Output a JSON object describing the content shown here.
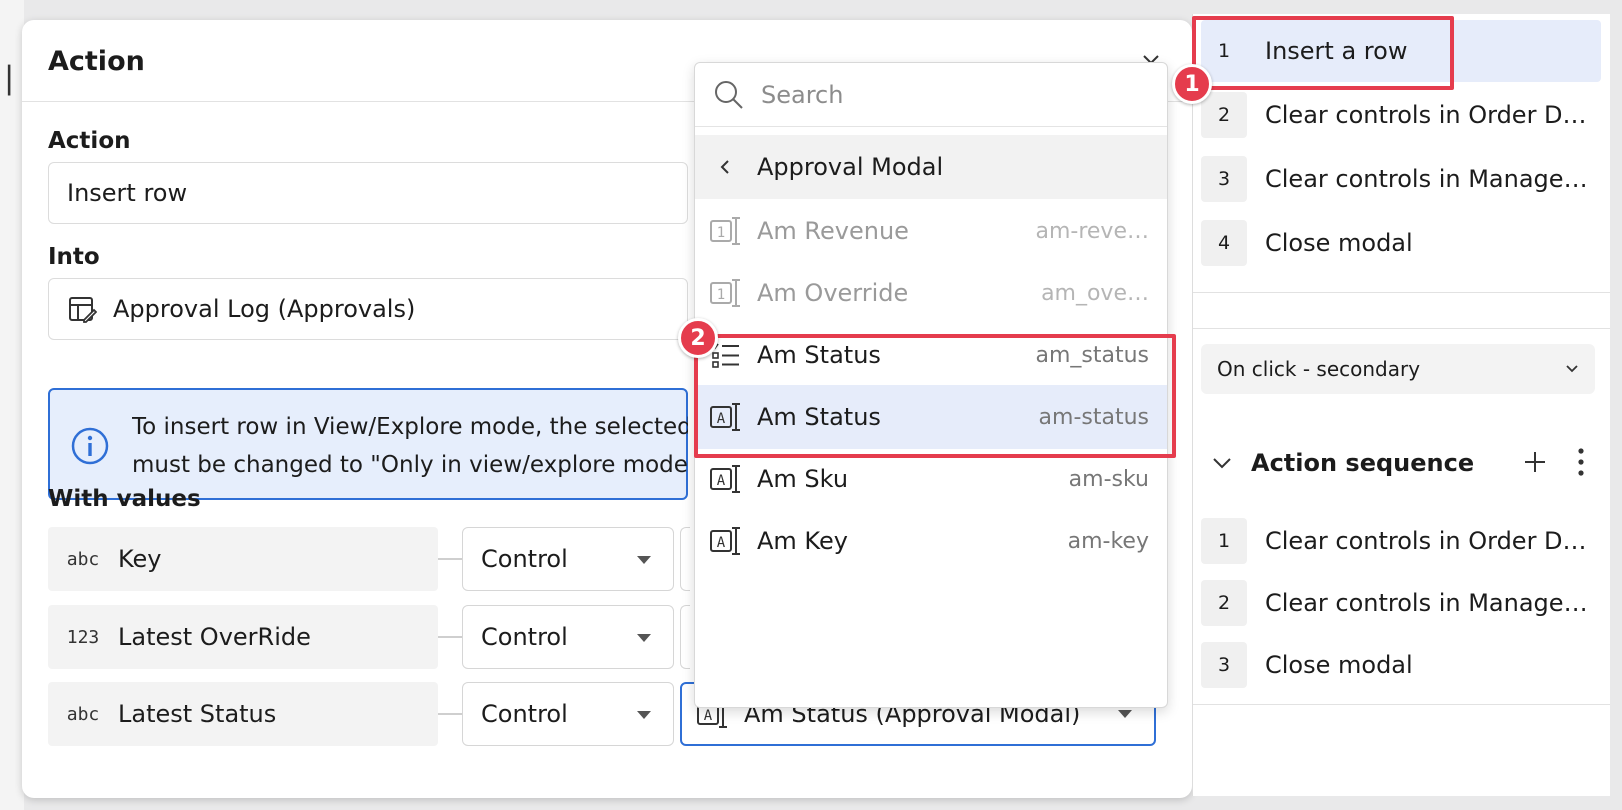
{
  "panel": {
    "title": "Action",
    "action_label": "Action",
    "action_value": "Insert row",
    "into_label": "Into",
    "into_value": "Approval Log (Approvals)",
    "info_line1": "To insert row in View/Explore mode, the selected",
    "info_line2": "must be changed to \"Only in view/explore mode\"",
    "with_values_label": "With values",
    "values": [
      {
        "type": "abc",
        "name": "Key",
        "control": "Control"
      },
      {
        "type": "123",
        "name": "Latest OverRide",
        "control": "Control"
      },
      {
        "type": "abc",
        "name": "Latest Status",
        "control": "Control",
        "selected": "Am Status (Approval Modal)"
      }
    ]
  },
  "dropdown": {
    "search_placeholder": "Search",
    "back_label": "Approval Modal",
    "items": [
      {
        "label": "Am Revenue",
        "id": "am-reve…",
        "icon": "number-control-icon"
      },
      {
        "label": "Am Override",
        "id": "am_ove…",
        "icon": "number-control-icon"
      },
      {
        "label": "Am Status",
        "id": "am_status",
        "icon": "list-control-icon"
      },
      {
        "label": "Am Status",
        "id": "am-status",
        "icon": "text-control-icon"
      },
      {
        "label": "Am Sku",
        "id": "am-sku",
        "icon": "text-control-icon"
      },
      {
        "label": "Am Key",
        "id": "am-key",
        "icon": "text-control-icon"
      }
    ]
  },
  "callouts": {
    "one": "1",
    "two": "2"
  },
  "sidebar": {
    "steps": [
      {
        "num": "1",
        "label": "Insert a row"
      },
      {
        "num": "2",
        "label": "Clear controls in Order D…"
      },
      {
        "num": "3",
        "label": "Clear controls in Manager…"
      },
      {
        "num": "4",
        "label": "Close modal"
      }
    ],
    "trigger": "On click - secondary",
    "sequence_title": "Action sequence",
    "sequence_steps": [
      {
        "num": "1",
        "label": "Clear controls in Order D…"
      },
      {
        "num": "2",
        "label": "Clear controls in Manager…"
      },
      {
        "num": "3",
        "label": "Close modal"
      }
    ]
  },
  "colors": {
    "accent": "#2f6fd6",
    "highlight": "#e53c4d",
    "selected_bg": "#e6ecfa"
  }
}
